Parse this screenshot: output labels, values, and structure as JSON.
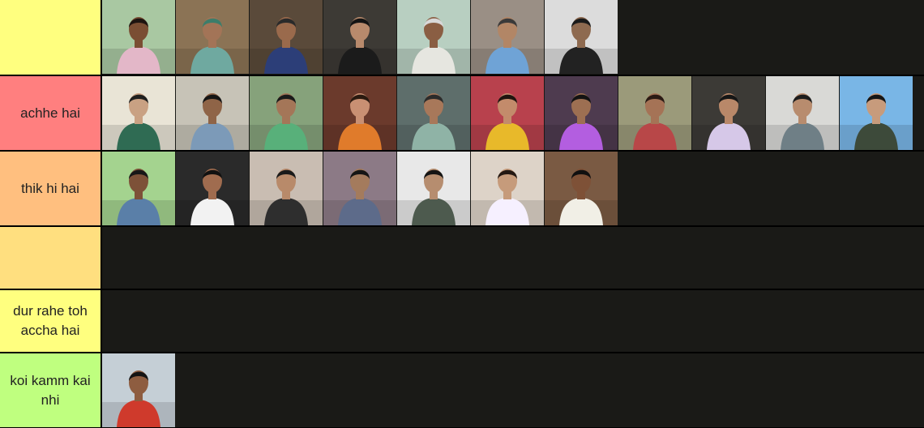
{
  "tiers": [
    {
      "label": "",
      "color": "#ffff7f",
      "items": [
        {
          "name": "man-pink-shirt-photo",
          "bg": "#a9c8a2",
          "fg": "#e3b7c8",
          "skin": "#7a4e33",
          "hair": "#1d1410"
        },
        {
          "name": "woman-green-dupatta-photo",
          "bg": "#8b7355",
          "fg": "#6fa9a0",
          "skin": "#a37457",
          "hair": "#3d7d6a"
        },
        {
          "name": "man-striped-tshirt-photo",
          "bg": "#5a4a3a",
          "fg": "#2c3e78",
          "skin": "#9a6a4c",
          "hair": "#2a2a2a"
        },
        {
          "name": "woman-black-hijab-photo",
          "bg": "#3d3a35",
          "fg": "#1b1b1b",
          "skin": "#b88a6c",
          "hair": "#141414"
        },
        {
          "name": "elderly-man-white-beard-photo",
          "bg": "#b8cfc1",
          "fg": "#e6e6e0",
          "skin": "#8a5e43",
          "hair": "#d8d8d8"
        },
        {
          "name": "man-blue-shirt-brick-wall-photo",
          "bg": "#9a8f85",
          "fg": "#6fa3d6",
          "skin": "#b28666",
          "hair": "#3a3a3a"
        },
        {
          "name": "man-black-shirt-curtain-photo",
          "bg": "#dcdcdc",
          "fg": "#222222",
          "skin": "#8e6a50",
          "hair": "#1a1a1a"
        }
      ]
    },
    {
      "label": "achhe hai",
      "color": "#ff7f7f",
      "items": [
        {
          "name": "woman-green-suit-photo",
          "bg": "#e9e4d6",
          "fg": "#2f6b53",
          "skin": "#c9a183",
          "hair": "#1f1f1f"
        },
        {
          "name": "boy-outdoor-village-photo",
          "bg": "#c7c3b7",
          "fg": "#7c9ab8",
          "skin": "#8f6447",
          "hair": "#151515"
        },
        {
          "name": "man-green-tshirt-garden-photo",
          "bg": "#86a27b",
          "fg": "#58b07a",
          "skin": "#a47658",
          "hair": "#1a1a1a"
        },
        {
          "name": "bride-orange-saree-photo",
          "bg": "#6b3a2c",
          "fg": "#e07b2b",
          "skin": "#c99073",
          "hair": "#2a1a10"
        },
        {
          "name": "woman-teal-dupatta-photo",
          "bg": "#5e6e6b",
          "fg": "#8fb3a6",
          "skin": "#a8785a",
          "hair": "#2b2b2b"
        },
        {
          "name": "woman-yellow-saree-flowers-photo",
          "bg": "#b8414d",
          "fg": "#e8b92a",
          "skin": "#c38b6b",
          "hair": "#1f140f"
        },
        {
          "name": "boy-purple-shirt-decor-photo",
          "bg": "#4e3b4f",
          "fg": "#b35ee0",
          "skin": "#9d6f52",
          "hair": "#131313"
        },
        {
          "name": "woman-red-dupatta-field-photo",
          "bg": "#9b9a7a",
          "fg": "#b84748",
          "skin": "#a57356",
          "hair": "#2a1a14"
        },
        {
          "name": "woman-floral-top-photo",
          "bg": "#3c3a36",
          "fg": "#d6c8e8",
          "skin": "#b98869",
          "hair": "#161616"
        },
        {
          "name": "man-grey-shirt-curtain-photo",
          "bg": "#d9d9d6",
          "fg": "#6f7f86",
          "skin": "#b88c6e",
          "hair": "#1d1d1d"
        },
        {
          "name": "young-man-blue-sky-photo",
          "bg": "#79b6e6",
          "fg": "#3d4a3a",
          "skin": "#c79b7c",
          "hair": "#161616"
        }
      ]
    },
    {
      "label": "thik hi hai",
      "color": "#ffbf7f",
      "items": [
        {
          "name": "man-blue-shirt-green-wall-photo",
          "bg": "#a4d38f",
          "fg": "#5a7fa8",
          "skin": "#7d5138",
          "hair": "#171717"
        },
        {
          "name": "man-red-sunglasses-photo",
          "bg": "#2a2a2a",
          "fg": "#f2f2f2",
          "skin": "#a06c4f",
          "hair": "#111111"
        },
        {
          "name": "boy-black-tshirt-photo",
          "bg": "#c9bdb2",
          "fg": "#2e2e2e",
          "skin": "#b88a6a",
          "hair": "#1a1a1a"
        },
        {
          "name": "boy-purple-flowers-photo",
          "bg": "#8c7a86",
          "fg": "#5d6b8a",
          "skin": "#a47b5d",
          "hair": "#151515"
        },
        {
          "name": "boy-light-flare-photo",
          "bg": "#e8e8e8",
          "fg": "#4d5a4e",
          "skin": "#b68d6f",
          "hair": "#141414"
        },
        {
          "name": "child-holding-drawing-photo",
          "bg": "#ddd3c8",
          "fg": "#f6f0ff",
          "skin": "#c69b7b",
          "hair": "#241812"
        },
        {
          "name": "young-man-closeup-photo",
          "bg": "#7a5a43",
          "fg": "#f1efe6",
          "skin": "#7e5137",
          "hair": "#101010"
        }
      ]
    },
    {
      "label": "",
      "color": "#ffdf7f",
      "items": []
    },
    {
      "label": "dur rahe toh accha hai",
      "color": "#ffff7f",
      "items": []
    },
    {
      "label": "koi kamm kai nhi",
      "color": "#bfff7f",
      "items": [
        {
          "name": "boy-red-tshirt-outdoor-photo",
          "bg": "#c5cfd6",
          "fg": "#cf3a2c",
          "skin": "#8e5d40",
          "hair": "#141414"
        }
      ]
    }
  ]
}
